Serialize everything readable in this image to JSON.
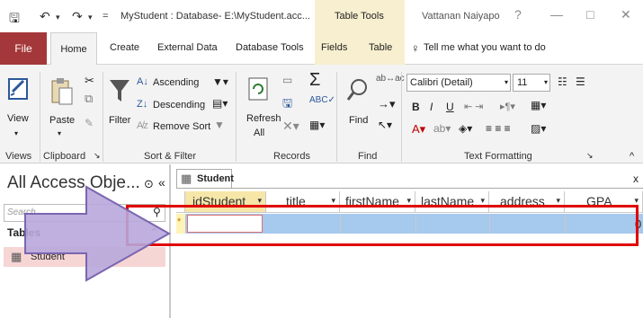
{
  "titlebar": {
    "save_icon": "save-icon",
    "undo_icon": "undo-icon",
    "redo_icon": "redo-icon",
    "title": "MyStudent : Database- E:\\MyStudent.acc...",
    "context_tab_group": "Table Tools",
    "user": "Vattanan Naiyapo",
    "help": "?",
    "minimize": "—",
    "restore": "□",
    "close": "✕"
  },
  "ribbon_tabs": [
    "File",
    "Home",
    "Create",
    "External Data",
    "Database Tools",
    "Fields",
    "Table"
  ],
  "tell_me": "Tell me what you want to do",
  "ribbon": {
    "views": {
      "view": "View",
      "group": "Views"
    },
    "clipboard": {
      "paste": "Paste",
      "group": "Clipboard"
    },
    "sort_filter": {
      "filter": "Filter",
      "ascending": "Ascending",
      "descending": "Descending",
      "remove_sort": "Remove Sort",
      "group": "Sort & Filter"
    },
    "records": {
      "refresh": "Refresh",
      "refresh_all": "All",
      "group": "Records"
    },
    "find": {
      "find": "Find",
      "group": "Find"
    },
    "text_formatting": {
      "font": "Calibri (Detail)",
      "size": "11",
      "bold": "B",
      "italic": "I",
      "underline": "U",
      "group": "Text Formatting"
    }
  },
  "nav": {
    "title": "All Access Obje...",
    "search_placeholder": "Search...",
    "section": "Tables",
    "item": "Student"
  },
  "document": {
    "tab": "Student",
    "close": "x",
    "columns": [
      "idStudent",
      "title",
      "firstName",
      "lastName",
      "address",
      "GPA"
    ],
    "new_record_marker": "*",
    "gpa_value": "0"
  }
}
